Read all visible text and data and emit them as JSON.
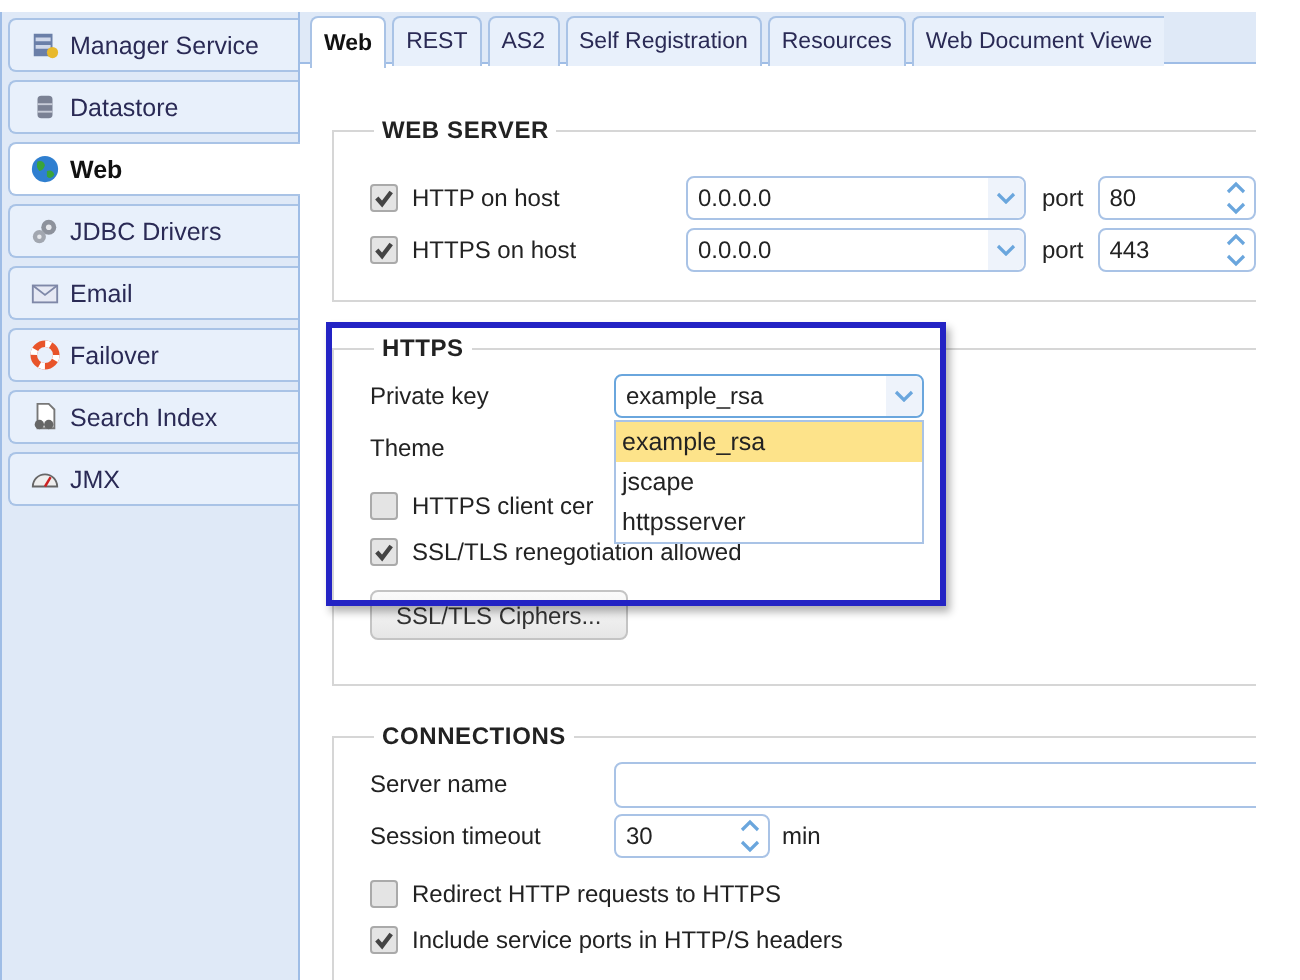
{
  "sidebar": {
    "items": [
      {
        "label": "Manager Service",
        "selected": false
      },
      {
        "label": "Datastore",
        "selected": false
      },
      {
        "label": "Web",
        "selected": true
      },
      {
        "label": "JDBC Drivers",
        "selected": false
      },
      {
        "label": "Email",
        "selected": false
      },
      {
        "label": "Failover",
        "selected": false
      },
      {
        "label": "Search Index",
        "selected": false
      },
      {
        "label": "JMX",
        "selected": false
      }
    ]
  },
  "tabs": [
    {
      "label": "Web",
      "selected": true
    },
    {
      "label": "REST",
      "selected": false
    },
    {
      "label": "AS2",
      "selected": false
    },
    {
      "label": "Self Registration",
      "selected": false
    },
    {
      "label": "Resources",
      "selected": false
    },
    {
      "label": "Web Document Viewe",
      "selected": false
    }
  ],
  "web_server": {
    "title": "WEB SERVER",
    "rows": [
      {
        "label": "HTTP on host",
        "checked": true,
        "host": "0.0.0.0",
        "port_label": "port",
        "port": "80"
      },
      {
        "label": "HTTPS on host",
        "checked": true,
        "host": "0.0.0.0",
        "port_label": "port",
        "port": "443"
      }
    ]
  },
  "https": {
    "title": "HTTPS",
    "private_key": {
      "label": "Private key",
      "value": "example_rsa",
      "expanded": true,
      "options": [
        {
          "label": "example_rsa",
          "selected": true
        },
        {
          "label": "jscape",
          "selected": false
        },
        {
          "label": "httpsserver",
          "selected": false
        }
      ]
    },
    "theme": {
      "label": "Theme"
    },
    "checks": [
      {
        "label": "HTTPS client cer",
        "checked": false
      },
      {
        "label": "SSL/TLS renegotiation allowed",
        "checked": true
      }
    ],
    "ciphers_button": "SSL/TLS Ciphers..."
  },
  "connections": {
    "title": "CONNECTIONS",
    "server_name": {
      "label": "Server name"
    },
    "session_timeout": {
      "label": "Session timeout",
      "value": "30",
      "unit": "min"
    },
    "checks": [
      {
        "label": "Redirect HTTP requests to HTTPS",
        "checked": false
      },
      {
        "label": "Include service ports in HTTP/S headers",
        "checked": true
      }
    ]
  }
}
